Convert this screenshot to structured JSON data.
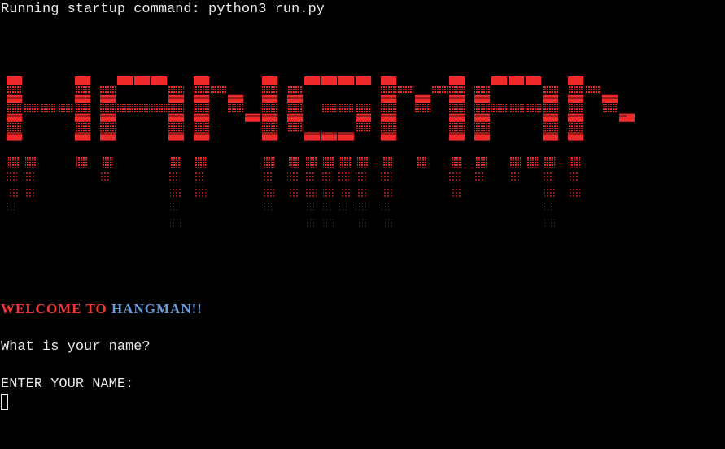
{
  "terminal": {
    "startup_line": "Running startup command: python3 run.py",
    "banner": {
      "text": "HANGMAN",
      "color": "#f02a2a"
    },
    "welcome": {
      "part1": "WELCOME TO",
      "part1_color": "#f23636",
      "part2": "HANGMAN!!",
      "part2_color": "#6a9ad8"
    },
    "question": "What is your name?",
    "prompt": "ENTER YOUR NAME:"
  }
}
